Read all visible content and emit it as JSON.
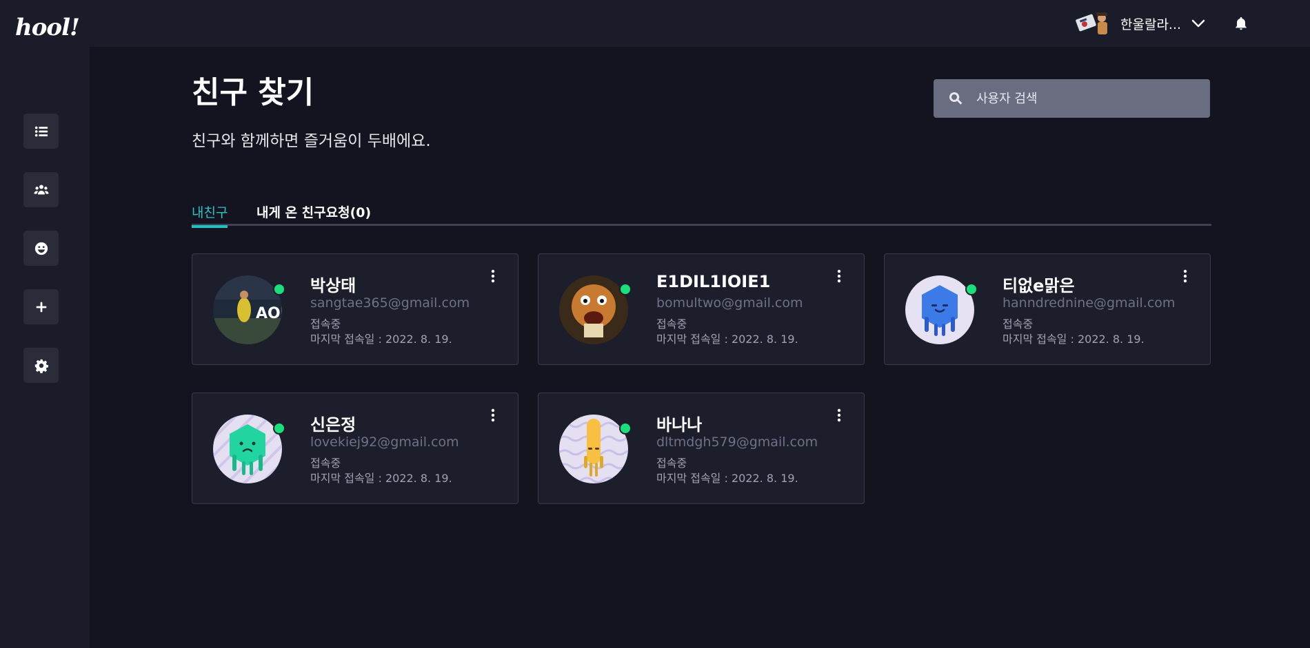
{
  "app": {
    "logo": "hool!"
  },
  "sidebar": {
    "items": [
      {
        "icon": "list-icon"
      },
      {
        "icon": "friends-icon"
      },
      {
        "icon": "smiley-icon"
      },
      {
        "icon": "plus-icon"
      },
      {
        "icon": "gear-icon"
      }
    ]
  },
  "topbar": {
    "user_name": "한울랄라...",
    "icons": [
      "chevron-down-icon",
      "bell-icon"
    ]
  },
  "page": {
    "title": "친구 찾기",
    "subtitle": "친구와 함께하면 즐거움이 두배에요."
  },
  "search": {
    "placeholder": "사용자 검색",
    "value": ""
  },
  "tabs": [
    {
      "label": "내친구",
      "active": true
    },
    {
      "label": "내게 온 친구요청(0)",
      "active": false
    }
  ],
  "friends": [
    {
      "name": "박상태",
      "email": "sangtae365@gmail.com",
      "status": "접속중",
      "last_login": "마지막 접속일 : 2022. 8. 19.",
      "online": true
    },
    {
      "name": "E1DIL1IOIE1",
      "email": "bomultwo@gmail.com",
      "status": "접속중",
      "last_login": "마지막 접속일 : 2022. 8. 19.",
      "online": true
    },
    {
      "name": "티없e맑은",
      "email": "hanndrednine@gmail.com",
      "status": "접속중",
      "last_login": "마지막 접속일 : 2022. 8. 19.",
      "online": true
    },
    {
      "name": "신은정",
      "email": "lovekiej92@gmail.com",
      "status": "접속중",
      "last_login": "마지막 접속일 : 2022. 8. 19.",
      "online": true
    },
    {
      "name": "바나나",
      "email": "dltmdgh579@gmail.com",
      "status": "접속중",
      "last_login": "마지막 접속일 : 2022. 8. 19.",
      "online": true
    }
  ],
  "colors": {
    "background": "#13141f",
    "panel": "#1b1c29",
    "card": "#1d1e2c",
    "accent": "#1cc4c4",
    "online": "#19e07a"
  }
}
